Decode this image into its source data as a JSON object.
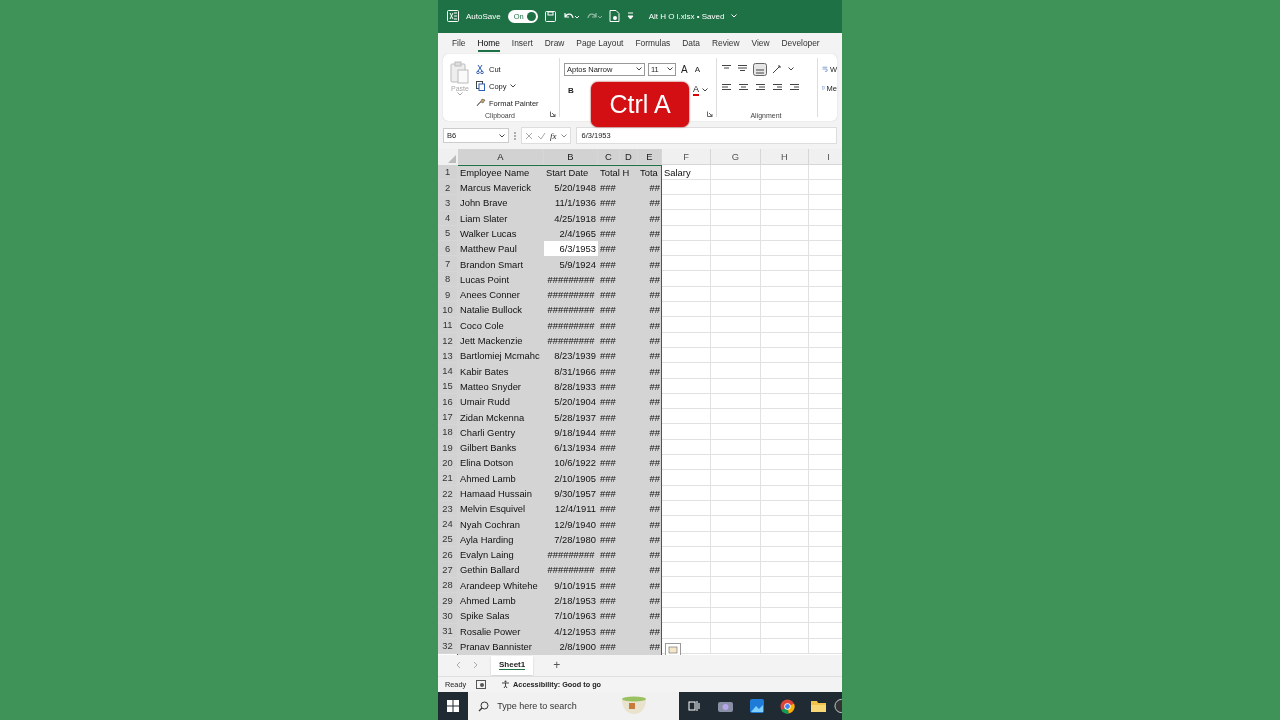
{
  "window": {
    "autosave_label": "AutoSave",
    "autosave": {
      "label": "On",
      "on": true
    },
    "title": "Alt H O l.xlsx • Saved"
  },
  "menu_tabs": [
    {
      "label": "File",
      "selected": false
    },
    {
      "label": "Home",
      "selected": true
    },
    {
      "label": "Insert",
      "selected": false
    },
    {
      "label": "Draw",
      "selected": false
    },
    {
      "label": "Page Layout",
      "selected": false
    },
    {
      "label": "Formulas",
      "selected": false
    },
    {
      "label": "Data",
      "selected": false
    },
    {
      "label": "Review",
      "selected": false
    },
    {
      "label": "View",
      "selected": false
    },
    {
      "label": "Developer",
      "selected": false
    }
  ],
  "ribbon": {
    "paste": {
      "label": "Paste",
      "disabled": true
    },
    "clipboard_items": [
      "Cut",
      "Copy",
      "Format Painter"
    ],
    "clipboard_group": "Clipboard",
    "font_name": "Aptos Narrow",
    "font_size": "11",
    "grow_font": "A",
    "shrink_font": "A",
    "bold": "B",
    "font_color": "A",
    "alignment_group": "Alignment",
    "wrap_text": "W",
    "merge": "Me"
  },
  "overlay": {
    "text": "Ctrl A"
  },
  "formula_bar": {
    "name_box": "B6",
    "fx": "fx",
    "value": "6/3/1953"
  },
  "sheet": {
    "columns": [
      {
        "label": "A",
        "selected": true
      },
      {
        "label": "B",
        "selected": true
      },
      {
        "label": "C",
        "selected": true
      },
      {
        "label": "D",
        "selected": true
      },
      {
        "label": "E",
        "selected": true
      },
      {
        "label": "F",
        "selected": false
      },
      {
        "label": "G",
        "selected": false
      },
      {
        "label": "H",
        "selected": false
      },
      {
        "label": "I",
        "selected": false
      }
    ],
    "rows": [
      {
        "header": "1",
        "selected": true,
        "active": false,
        "cells": [
          "Employee Name",
          "Start Date",
          "Total H",
          "",
          "Tota",
          "Salary"
        ]
      },
      {
        "header": "2",
        "selected": true,
        "active": false,
        "cells": [
          "Marcus Maverick",
          "5/20/1948",
          "###",
          "",
          "##"
        ]
      },
      {
        "header": "3",
        "selected": true,
        "active": false,
        "cells": [
          "John Brave",
          "11/1/1936",
          "###",
          "",
          "##"
        ]
      },
      {
        "header": "4",
        "selected": true,
        "active": false,
        "cells": [
          "Liam Slater",
          "4/25/1918",
          "###",
          "",
          "##"
        ]
      },
      {
        "header": "5",
        "selected": true,
        "active": false,
        "cells": [
          "Walker Lucas",
          "2/4/1965",
          "###",
          "",
          "##"
        ]
      },
      {
        "header": "6",
        "selected": true,
        "active": true,
        "cells": [
          "Matthew Paul",
          "6/3/1953",
          "###",
          "",
          "##"
        ]
      },
      {
        "header": "7",
        "selected": true,
        "active": false,
        "cells": [
          "Brandon Smart",
          "5/9/1924",
          "###",
          "",
          "##"
        ]
      },
      {
        "header": "8",
        "selected": true,
        "active": false,
        "cells": [
          "Lucas Point",
          "#########",
          "###",
          "",
          "##"
        ]
      },
      {
        "header": "9",
        "selected": true,
        "active": false,
        "cells": [
          "Anees Conner",
          "#########",
          "###",
          "",
          "##"
        ]
      },
      {
        "header": "10",
        "selected": true,
        "active": false,
        "cells": [
          "Natalie Bullock",
          "#########",
          "###",
          "",
          "##"
        ]
      },
      {
        "header": "11",
        "selected": true,
        "active": false,
        "cells": [
          "Coco Cole",
          "#########",
          "###",
          "",
          "##"
        ]
      },
      {
        "header": "12",
        "selected": true,
        "active": false,
        "cells": [
          "Jett Mackenzie",
          "#########",
          "###",
          "",
          "##"
        ]
      },
      {
        "header": "13",
        "selected": true,
        "active": false,
        "cells": [
          "Bartlomiej Mcmahc",
          "8/23/1939",
          "###",
          "",
          "##"
        ]
      },
      {
        "header": "14",
        "selected": true,
        "active": false,
        "cells": [
          "Kabir Bates",
          "8/31/1966",
          "###",
          "",
          "##"
        ]
      },
      {
        "header": "15",
        "selected": true,
        "active": false,
        "cells": [
          "Matteo Snyder",
          "8/28/1933",
          "###",
          "",
          "##"
        ]
      },
      {
        "header": "16",
        "selected": true,
        "active": false,
        "cells": [
          "Umair Rudd",
          "5/20/1904",
          "###",
          "",
          "##"
        ]
      },
      {
        "header": "17",
        "selected": true,
        "active": false,
        "cells": [
          "Zidan Mckenna",
          "5/28/1937",
          "###",
          "",
          "##"
        ]
      },
      {
        "header": "18",
        "selected": true,
        "active": false,
        "cells": [
          "Charli Gentry",
          "9/18/1944",
          "###",
          "",
          "##"
        ]
      },
      {
        "header": "19",
        "selected": true,
        "active": false,
        "cells": [
          "Gilbert Banks",
          "6/13/1934",
          "###",
          "",
          "##"
        ]
      },
      {
        "header": "20",
        "selected": true,
        "active": false,
        "cells": [
          "Elina Dotson",
          "10/6/1922",
          "###",
          "",
          "##"
        ]
      },
      {
        "header": "21",
        "selected": true,
        "active": false,
        "cells": [
          "Ahmed Lamb",
          "2/10/1905",
          "###",
          "",
          "##"
        ]
      },
      {
        "header": "22",
        "selected": true,
        "active": false,
        "cells": [
          "Hamaad Hussain",
          "9/30/1957",
          "###",
          "",
          "##"
        ]
      },
      {
        "header": "23",
        "selected": true,
        "active": false,
        "cells": [
          "Melvin Esquivel",
          "12/4/1911",
          "###",
          "",
          "##"
        ]
      },
      {
        "header": "24",
        "selected": true,
        "active": false,
        "cells": [
          "Nyah Cochran",
          "12/9/1940",
          "###",
          "",
          "##"
        ]
      },
      {
        "header": "25",
        "selected": true,
        "active": false,
        "cells": [
          "Ayla Harding",
          "7/28/1980",
          "###",
          "",
          "##"
        ]
      },
      {
        "header": "26",
        "selected": true,
        "active": false,
        "cells": [
          "Evalyn Laing",
          "#########",
          "###",
          "",
          "##"
        ]
      },
      {
        "header": "27",
        "selected": true,
        "active": false,
        "cells": [
          "Gethin Ballard",
          "#########",
          "###",
          "",
          "##"
        ]
      },
      {
        "header": "28",
        "selected": true,
        "active": false,
        "cells": [
          "Arandeep Whitehe",
          "9/10/1915",
          "###",
          "",
          "##"
        ]
      },
      {
        "header": "29",
        "selected": true,
        "active": false,
        "cells": [
          "Ahmed Lamb",
          "2/18/1953",
          "###",
          "",
          "##"
        ]
      },
      {
        "header": "30",
        "selected": true,
        "active": false,
        "cells": [
          "Spike Salas",
          "7/10/1963",
          "###",
          "",
          "##"
        ]
      },
      {
        "header": "31",
        "selected": true,
        "active": false,
        "cells": [
          "Rosalie Power",
          "4/12/1953",
          "###",
          "",
          "##"
        ]
      },
      {
        "header": "32",
        "selected": true,
        "active": false,
        "cells": [
          "Pranav Bannister",
          "2/8/1900",
          "###",
          "",
          "##"
        ]
      }
    ]
  },
  "sheet_tabs": [
    {
      "label": "Sheet1",
      "selected": true
    }
  ],
  "add_sheet": "+",
  "status_bar": {
    "mode": "Ready",
    "accessibility": "Accessibility: Good to go"
  },
  "taskbar": {
    "search": {
      "placeholder": "Type here to search"
    }
  }
}
